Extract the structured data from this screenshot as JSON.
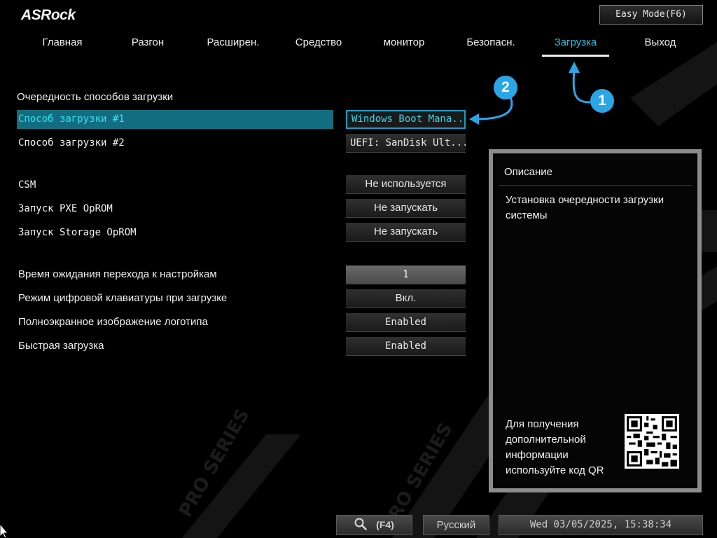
{
  "header": {
    "logo": "ASRock",
    "easy_mode_label": "Easy Mode(F6)"
  },
  "tabs": [
    {
      "label": "Главная",
      "active": false
    },
    {
      "label": "Разгон",
      "active": false
    },
    {
      "label": "Расширен.",
      "active": false
    },
    {
      "label": "Средство",
      "active": false
    },
    {
      "label": "монитор",
      "active": false
    },
    {
      "label": "Безопасн.",
      "active": false
    },
    {
      "label": "Загрузка",
      "active": true
    },
    {
      "label": "Выход",
      "active": false
    }
  ],
  "settings": {
    "section_title": "Очередность способов загрузки",
    "rows": [
      {
        "label": "Способ загрузки #1",
        "value": "Windows Boot Mana...",
        "selected": true
      },
      {
        "label": "Способ загрузки #2",
        "value": "UEFI: SanDisk Ult..."
      },
      {
        "label": "CSM",
        "value": "Не используется"
      },
      {
        "label": "Запуск PXE OpROM",
        "value": "Не запускать"
      },
      {
        "label": "Запуск Storage OpROM",
        "value": "Не запускать"
      },
      {
        "label": "Время ожидания перехода к настройкам",
        "value": "1"
      },
      {
        "label": "Режим цифровой клавиатуры при загрузке",
        "value": "Вкл."
      },
      {
        "label": "Полноэкранное изображение логотипа",
        "value": "Enabled"
      },
      {
        "label": "Быстрая загрузка",
        "value": "Enabled"
      }
    ]
  },
  "description": {
    "title": "Описание",
    "text": "Установка очередности загрузки системы",
    "qr_text": "Для получения дополнительной информации используйте код QR"
  },
  "annotations": {
    "badge_1": "1",
    "badge_2": "2"
  },
  "bottom": {
    "search_key": "(F4)",
    "language": "Русский",
    "datetime": "Wed 03/05/2025, 15:38:34"
  },
  "background_watermark": "PRO SERIES",
  "colors": {
    "accent": "#2bbfe0",
    "selected_row": "#136d80",
    "badge": "#2aa6e6"
  }
}
